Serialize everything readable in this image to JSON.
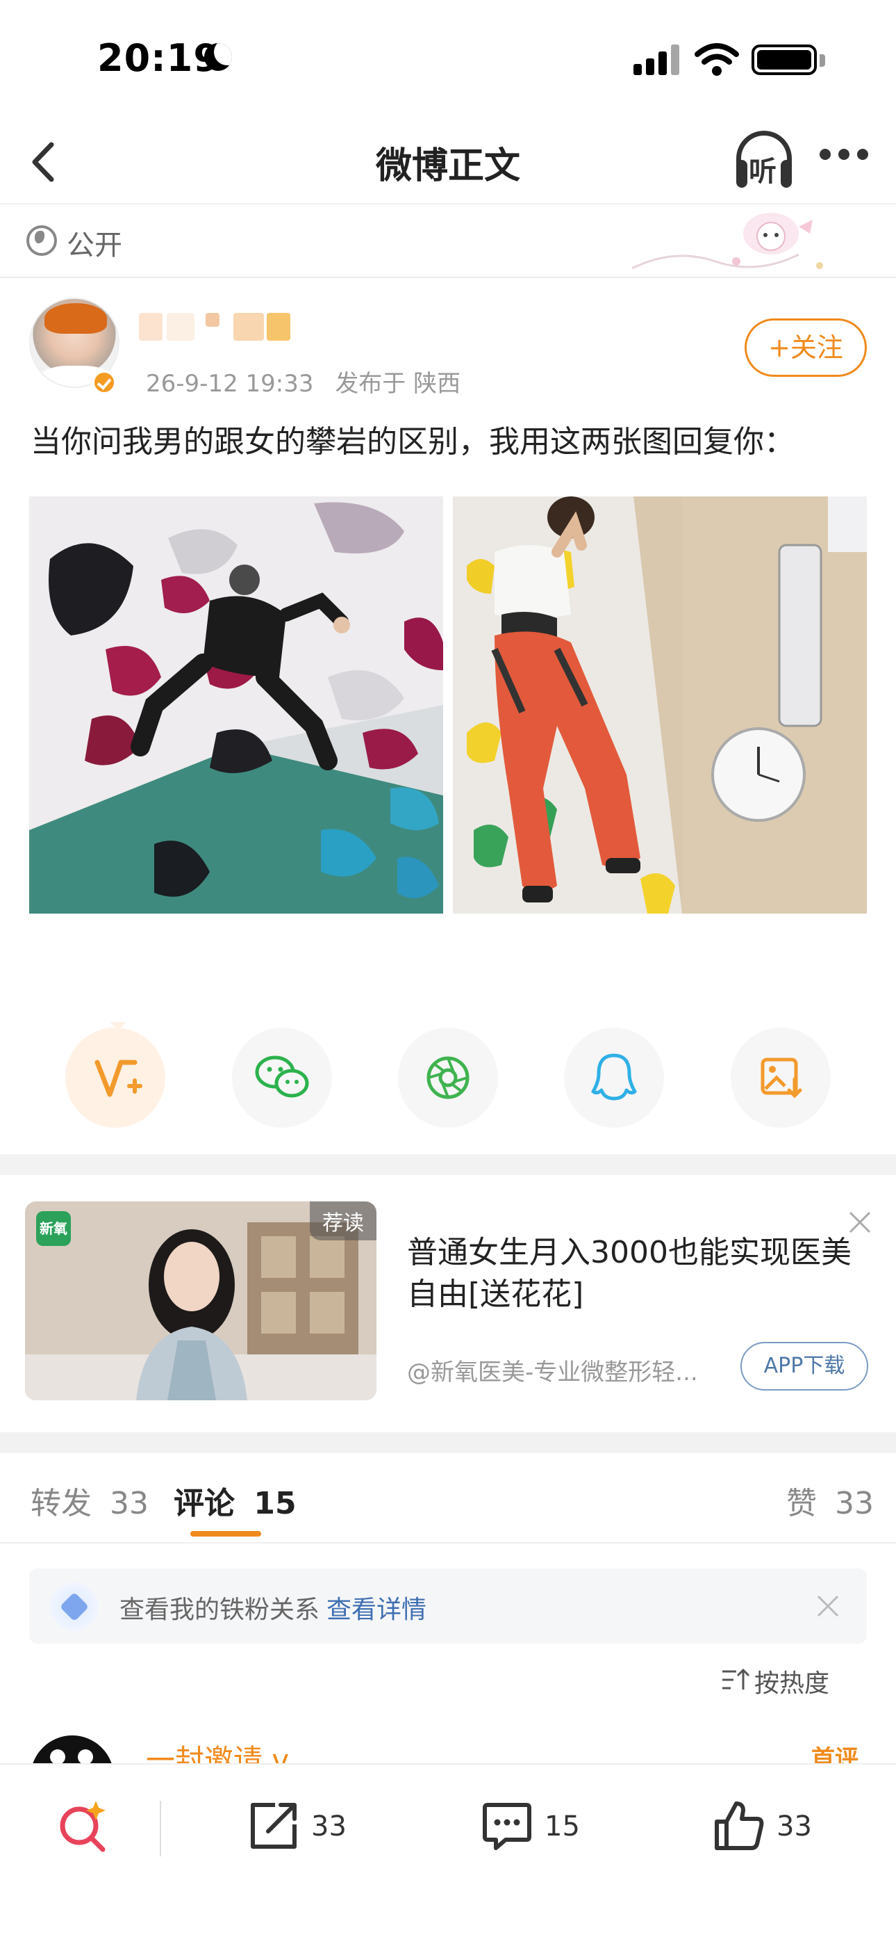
{
  "status_bar": {
    "time": "20:19"
  },
  "nav": {
    "title": "微博正文",
    "listen_label": "听"
  },
  "visibility": {
    "label": "公开"
  },
  "post": {
    "timestamp": "26-9-12 19:33",
    "location": "发布于 陕西",
    "follow_label": "+关注",
    "text": "当你问我男的跟女的攀岩的区别，我用这两张图回复你："
  },
  "share_targets": [
    {
      "icon": "vip-share-icon"
    },
    {
      "icon": "wechat-icon"
    },
    {
      "icon": "moments-icon"
    },
    {
      "icon": "qq-icon"
    },
    {
      "icon": "save-image-icon"
    }
  ],
  "ad": {
    "brand": "新氧",
    "tag": "荐读",
    "title": "普通女生月入3000也能实现医美自由[送花花]",
    "source": "@新氧医美-专业微整形轻...",
    "cta": "APP下载"
  },
  "tabs": {
    "repost": {
      "label": "转发",
      "count": "33"
    },
    "comment": {
      "label": "评论",
      "count": "15"
    },
    "like": {
      "label": "赞",
      "count": "33"
    }
  },
  "fan_bar": {
    "text": "查看我的铁粉关系",
    "link": "查看详情"
  },
  "sort": {
    "label": "按热度"
  },
  "comment_preview": {
    "name": "一封邀请 v",
    "badge": "首评"
  },
  "bottom_bar": {
    "repost_count": "33",
    "comment_count": "15",
    "like_count": "33"
  },
  "colors": {
    "accent": "#f08a1c",
    "link": "#3e6fb1"
  }
}
